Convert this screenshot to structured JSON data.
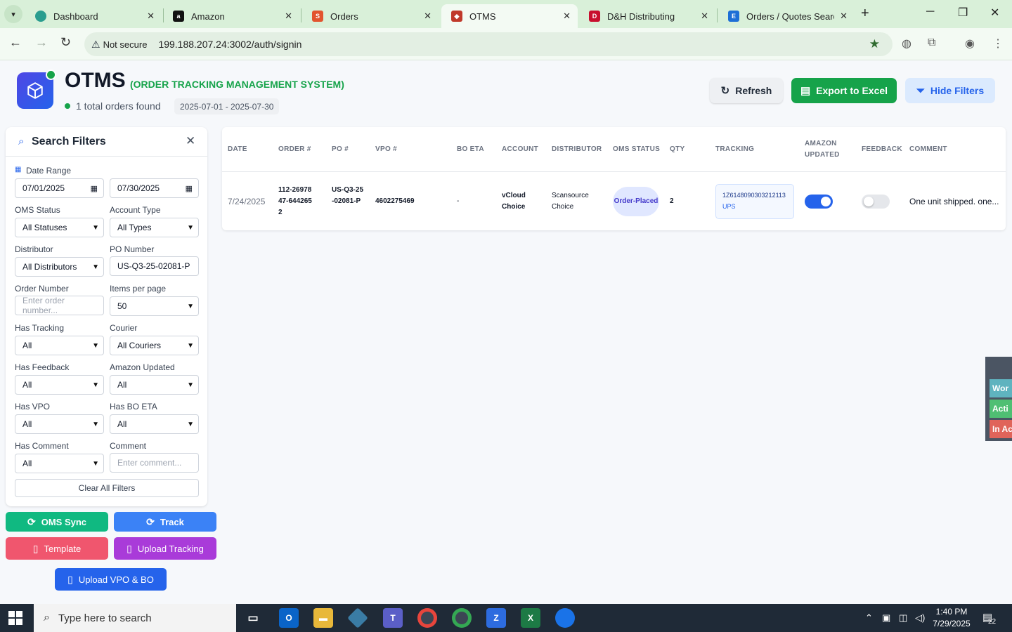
{
  "browser": {
    "tabs": [
      {
        "title": "Dashboard",
        "active": false,
        "fav": "dashboard-favicon",
        "color": "#2a9d8f"
      },
      {
        "title": "Amazon",
        "active": false,
        "fav": "amazon-favicon",
        "color": "#111111"
      },
      {
        "title": "Orders",
        "active": false,
        "fav": "orders-favicon",
        "color": "#e2542e"
      },
      {
        "title": "OTMS",
        "active": true,
        "fav": "otms-favicon",
        "color": "#c0392b"
      },
      {
        "title": "D&H Distributing",
        "active": false,
        "fav": "dh-favicon",
        "color": "#c8102e"
      },
      {
        "title": "Orders / Quotes Search",
        "active": false,
        "fav": "ec-favicon",
        "color": "#1d6fd6"
      }
    ],
    "address": {
      "security_label": "Not secure",
      "url": "199.188.207.24:3002/auth/signin"
    }
  },
  "header": {
    "title": "OTMS",
    "subtitle": "(ORDER TRACKING MANAGEMENT SYSTEM)",
    "orders_found": "1 total orders found",
    "date_range": "2025-07-01 - 2025-07-30",
    "buttons": {
      "refresh": "Refresh",
      "export": "Export to Excel",
      "hide_filters": "Hide Filters"
    },
    "colors": {
      "export": "#16a34a",
      "hide_filters_bg": "#dbeafe",
      "accent": "#2563eb"
    }
  },
  "filters": {
    "title": "Search Filters",
    "date_range_label": "Date Range",
    "date_from": "07/01/2025",
    "date_to": "07/30/2025",
    "oms_status_label": "OMS Status",
    "oms_status_value": "All Statuses",
    "account_type_label": "Account Type",
    "account_type_value": "All Types",
    "distributor_label": "Distributor",
    "distributor_value": "All Distributors",
    "po_number_label": "PO Number",
    "po_number_value": "US-Q3-25-02081-P",
    "order_number_label": "Order Number",
    "order_number_placeholder": "Enter order number...",
    "items_per_page_label": "Items per page",
    "items_per_page_value": "50",
    "has_tracking_label": "Has Tracking",
    "has_tracking_value": "All",
    "courier_label": "Courier",
    "courier_value": "All Couriers",
    "has_feedback_label": "Has Feedback",
    "has_feedback_value": "All",
    "amazon_updated_label": "Amazon Updated",
    "amazon_updated_value": "All",
    "has_vpo_label": "Has VPO",
    "has_vpo_value": "All",
    "has_bo_eta_label": "Has BO ETA",
    "has_bo_eta_value": "All",
    "has_comment_label": "Has Comment",
    "has_comment_value": "All",
    "comment_label": "Comment",
    "comment_placeholder": "Enter comment...",
    "clear_label": "Clear All Filters"
  },
  "actions": {
    "oms_sync": "OMS Sync",
    "track": "Track",
    "template": "Template",
    "upload_tracking": "Upload Tracking",
    "upload_vpo_bo": "Upload VPO & BO"
  },
  "table": {
    "columns": [
      "DATE",
      "ORDER #",
      "PO #",
      "VPO #",
      "BO ETA",
      "ACCOUNT",
      "DISTRIBUTOR",
      "OMS STATUS",
      "QTY",
      "TRACKING",
      "AMAZON UPDATED",
      "FEEDBACK",
      "COMMENT"
    ],
    "rows": [
      {
        "date": "7/24/2025",
        "order": "112-2697847-6442652",
        "po": "US-Q3-25-02081-P",
        "vpo": "4602275469",
        "bo_eta": "-",
        "account": "vCloud Choice",
        "distributor": "Scansource Choice",
        "oms_status": "Order-Placed",
        "qty": "2",
        "tracking_number": "1Z6148090303212113",
        "courier": "UPS",
        "amazon_updated": true,
        "feedback": false,
        "comment": "One unit shipped. one..."
      }
    ]
  },
  "side_widget": {
    "items": [
      {
        "label": "Wor",
        "color": "#5fb3bf"
      },
      {
        "label": "Acti",
        "color": "#4fbf73"
      },
      {
        "label": "In Ac",
        "color": "#e0645a"
      }
    ]
  },
  "taskbar": {
    "search_placeholder": "Type here to search",
    "time": "1:40 PM",
    "date": "7/29/2025",
    "notification_count": "22"
  }
}
